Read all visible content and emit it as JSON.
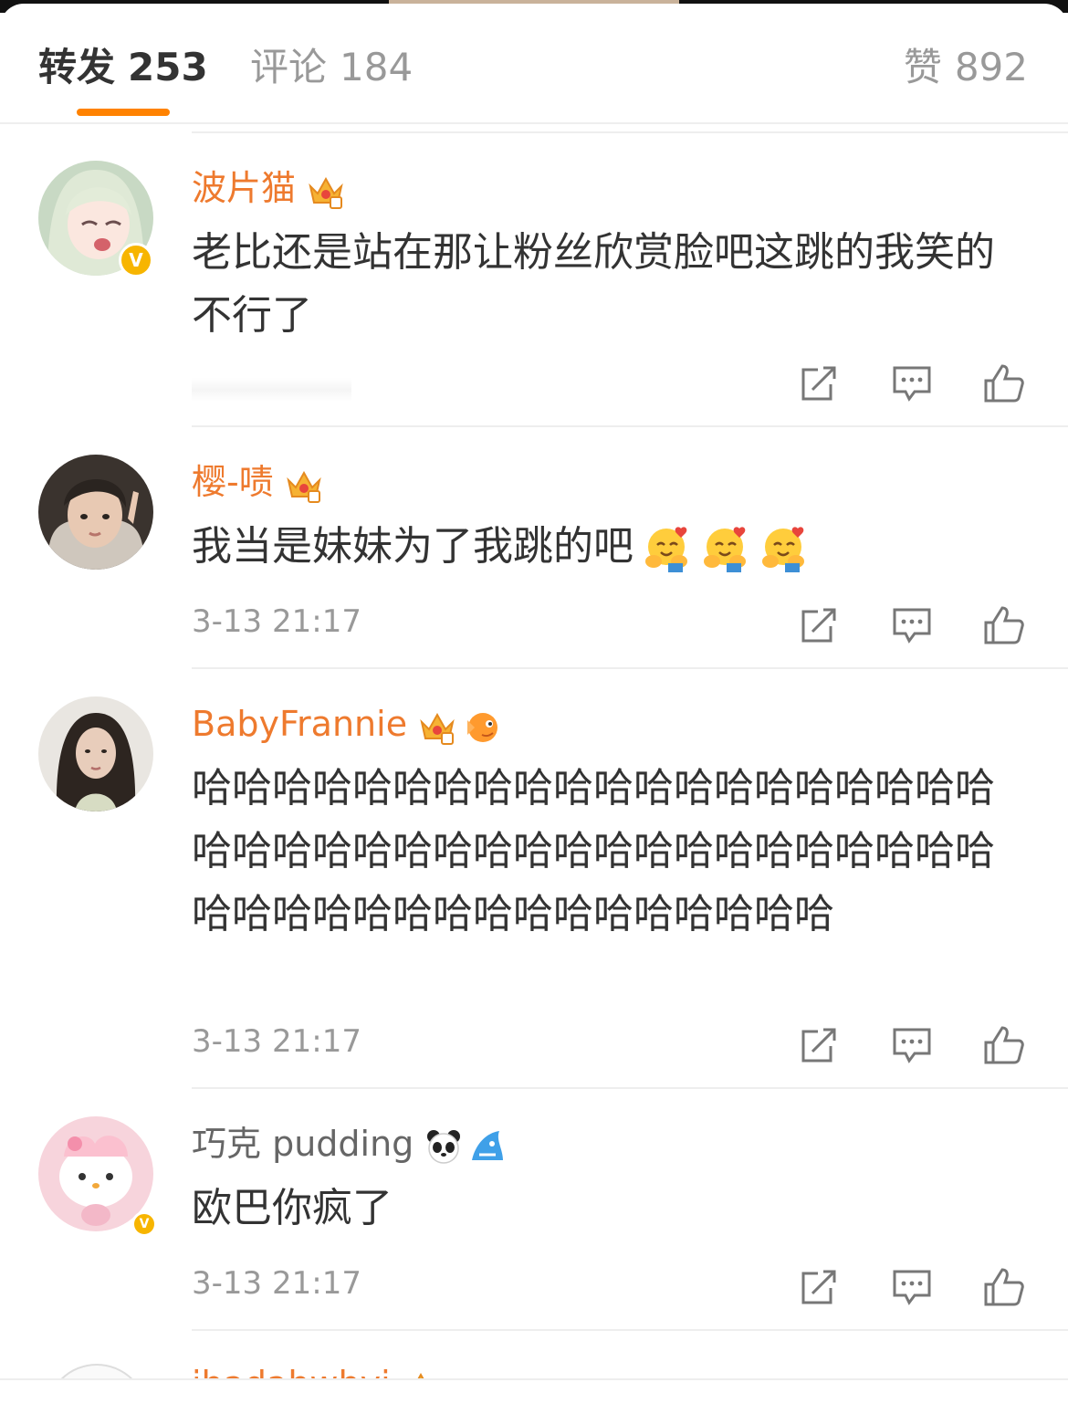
{
  "tabs": {
    "repost": {
      "label": "转发",
      "count": "253"
    },
    "comment": {
      "label": "评论",
      "count": "184"
    },
    "like": {
      "label": "赞",
      "count": "892"
    }
  },
  "comments": [
    {
      "username": "波片猫",
      "text": "老比还是站在那让粉丝欣赏脸吧这跳的我笑的不行了",
      "time": ""
    },
    {
      "username": "樱-啧",
      "text": "我当是妹妹为了我跳的吧",
      "time": "3-13 21:17"
    },
    {
      "username": "BabyFrannie",
      "text": "哈哈哈哈哈哈哈哈哈哈哈哈哈哈哈哈哈哈哈哈哈哈哈哈哈哈哈哈哈哈哈哈哈哈哈哈哈哈哈哈哈哈哈哈哈哈哈哈哈哈哈哈哈哈哈哈",
      "time": "3-13 21:17"
    },
    {
      "username": "巧克 pudding",
      "text": "欧巴你疯了",
      "time": "3-13 21:17"
    },
    {
      "username": "jhadahwhyi"
    }
  ],
  "colors": {
    "accent": "#ff8200",
    "member_name": "#ee7a2e",
    "verified": "#f7b500"
  }
}
